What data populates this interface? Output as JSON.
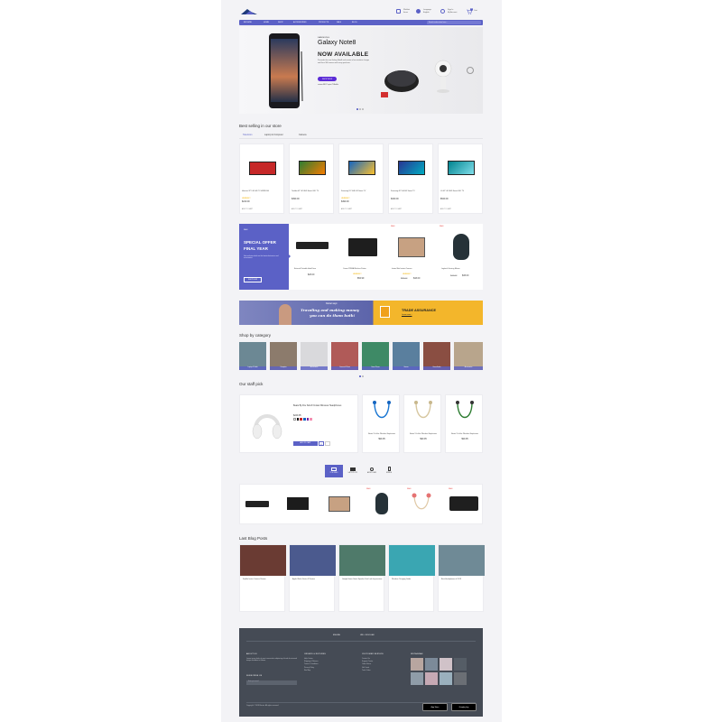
{
  "header": {
    "menu_wishlist": [
      "Wishlist",
      "Items"
    ],
    "menu_language": [
      "Language",
      "English"
    ],
    "menu_account": [
      "Sign In",
      "My Account"
    ],
    "cart_count": "0",
    "cart_label": "Cart"
  },
  "nav": {
    "items": [
      "BROWSE",
      "HOME",
      "SHOP",
      "ACCESSORIES",
      "PRODUCTS",
      "SALE",
      "BLOG"
    ],
    "search_placeholder": "Search entire store here..."
  },
  "hero": {
    "brand": "SAMSUNG",
    "title": "Galaxy Note8",
    "headline": "NOW AVAILABLE",
    "description": "Pre-order the new Galaxy Note8 and receive a free wireless charger and Gear 360 camera with every purchase.",
    "button": "SHOP NOW",
    "carriers": "verizon  AT&T  sprint  T-Mobile"
  },
  "best_selling": {
    "title": "Best selling in our store",
    "tabs": [
      "Television",
      "Laptop & Computer",
      "Camera"
    ],
    "add_to_cart": "ADD TO CART",
    "products": [
      {
        "name": "Hisense 32\" LED HD TV H32B5100",
        "price": "$219.00",
        "rating": 4
      },
      {
        "name": "Toshiba 43\" 4K UHD Smart LED TV",
        "price": "$399.00",
        "rating": 0
      },
      {
        "name": "Samsung 55\" UHD 4K Smart TV",
        "price": "$499.00",
        "rating": 4
      },
      {
        "name": "Samsung 40\" Full HD Smart TV",
        "price": "$329.00",
        "rating": 0
      },
      {
        "name": "LG 49\" 4K UHD Smart LED TV",
        "price": "$549.00",
        "rating": 0
      }
    ]
  },
  "special_offer": {
    "tag": "SALE",
    "title_line1": "SPECIAL OFFER",
    "title_line2": "FINAL YEAR",
    "description": "Get exclusive deals on the latest electronics and accessories.",
    "button": "SHOP NOW",
    "products": [
      {
        "name": "External Portable Hard Drive",
        "price": "$23.00",
        "old": "",
        "sale": ""
      },
      {
        "name": "Canon PIXMA Wireless Printer",
        "price": "$54.99",
        "old": "",
        "sale": ""
      },
      {
        "name": "Instax Mini Instant Camera",
        "price": "$43.00",
        "old": "$56.00",
        "sale": "SALE"
      },
      {
        "name": "Logitech Gaming Mouse",
        "price": "$33.00",
        "old": "$44.00",
        "sale": "SALE"
      }
    ]
  },
  "banner": {
    "tag": "Daniel says:",
    "quote_line1": "Traveling and making money",
    "quote_line2": "you can do them both!",
    "trade_title": "TRADE ASSURANCE",
    "trade_link": "Learn more ›"
  },
  "categories": {
    "title": "Shop by category",
    "items": [
      "Laptop & Tablet",
      "Computer",
      "Accessories",
      "Camera & Photo",
      "Smart Phone",
      "Games",
      "Home Audio",
      "Accessories"
    ]
  },
  "staff_pick": {
    "title": "Our staff pick",
    "featured": {
      "name": "Beats By Dre Solo3 On-Ear Wireless Headphones",
      "price": "$249.95",
      "button": "ADD TO CART"
    },
    "items": [
      {
        "name": "Beats X In-Ear Wireless Earphones",
        "price": "$99.95"
      },
      {
        "name": "Beats X In-Ear Wireless Earphones",
        "price": "$99.95"
      },
      {
        "name": "Beats X In-Ear Wireless Earphones",
        "price": "$99.95"
      }
    ]
  },
  "icon_tabs": [
    "TV & VIDEO",
    "LAPTOP & PC",
    "AUDIO & HIFI",
    "MOBILE"
  ],
  "strip_sale": "SALE",
  "blog": {
    "title": "Last Blog Posts",
    "posts": [
      {
        "title": "Fujifilm Instax Camera Review"
      },
      {
        "title": "Apple Watch Series 3 Review"
      },
      {
        "title": "Google Home Smart Speaker First Look Impressions"
      },
      {
        "title": "Wireless Charging Guide"
      },
      {
        "title": "Best Headphones of 2018"
      }
    ]
  },
  "footer": {
    "language": "ENGLISH",
    "currency": "USD - US DOLLAR",
    "about_title": "ABOUT US",
    "about_text": "Lorem ipsum dolor sit amet consectetur adipiscing elit sed do eiusmod tempor incididunt ut labore.",
    "newsletter_title": "SUBSCRIBE US",
    "newsletter_placeholder": "Enter your email",
    "col2_title": "ORDERS & RETURNS",
    "col2_links": [
      "Help Center",
      "Shipping & Returns",
      "Terms & Conditions",
      "Privacy Policy",
      "Site Map"
    ],
    "col3_title": "CUSTOMER SERVICE",
    "col3_links": [
      "Contact Us",
      "Support Center",
      "Order Status",
      "Gift Cards",
      "Track Order"
    ],
    "col4_title": "INSTAGRAM",
    "copyright": "Copyright © 2018 Electro. All rights reserved.",
    "app_store": "App Store",
    "google_play": "Google play"
  }
}
